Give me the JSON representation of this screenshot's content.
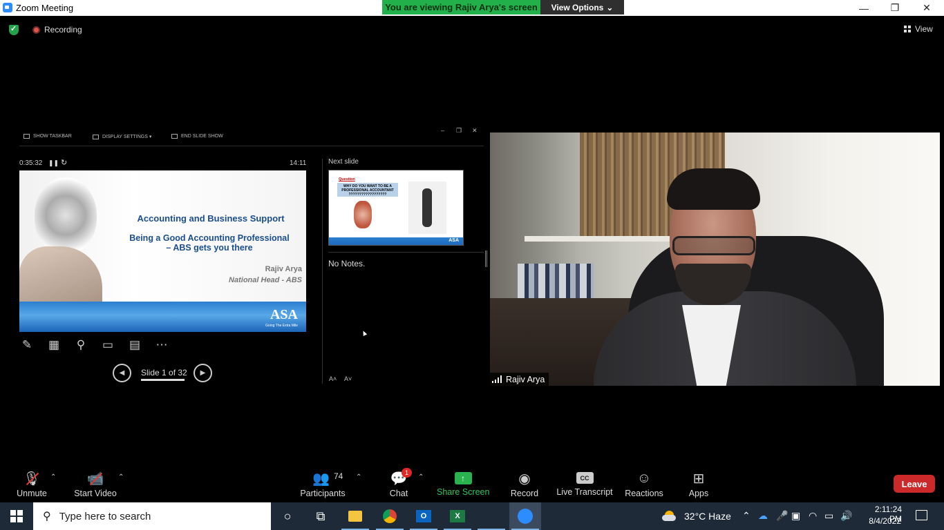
{
  "window": {
    "title": "Zoom Meeting"
  },
  "banner": {
    "text": "You are viewing Rajiv Arya's screen",
    "view_options": "View Options"
  },
  "status": {
    "recording": "Recording",
    "view": "View"
  },
  "presenter": {
    "toolbar": {
      "show_taskbar": "SHOW TASKBAR",
      "display_settings": "DISPLAY SETTINGS ▾",
      "end_show": "END SLIDE SHOW"
    },
    "elapsed": "0:35:32",
    "clock": "14:11",
    "slide": {
      "title": "Accounting and Business Support",
      "subtitle_line1": "Being a Good Accounting Professional",
      "subtitle_line2": "– ABS gets you there",
      "name": "Rajiv Arya",
      "role": "National Head - ABS",
      "logo": "ASA",
      "tagline": "Going The Extra Mile"
    },
    "next_slide": {
      "label": "Next slide",
      "question": "Question",
      "box_line1": "WHY DO YOU WANT TO BE A",
      "box_line2": "PROFESSIONAL ACCOUNTANT",
      "box_line3": "??????????????????",
      "logo": "ASA"
    },
    "notes": "No Notes.",
    "slide_counter": "Slide 1 of 32"
  },
  "video": {
    "participant_name": "Rajiv Arya"
  },
  "toolbar": {
    "unmute": "Unmute",
    "start_video": "Start Video",
    "participants": "Participants",
    "participant_count": "74",
    "chat": "Chat",
    "chat_badge": "1",
    "share_screen": "Share Screen",
    "record": "Record",
    "live_transcript": "Live Transcript",
    "cc": "CC",
    "reactions": "Reactions",
    "apps": "Apps",
    "leave": "Leave"
  },
  "taskbar": {
    "search_placeholder": "Type here to search",
    "weather": "32°C  Haze",
    "time": "2:11:24 PM",
    "date": "8/4/2022"
  },
  "colors": {
    "accent_green": "#22b04b",
    "leave_red": "#cc2a2a",
    "slide_blue": "#1a4d8f"
  }
}
